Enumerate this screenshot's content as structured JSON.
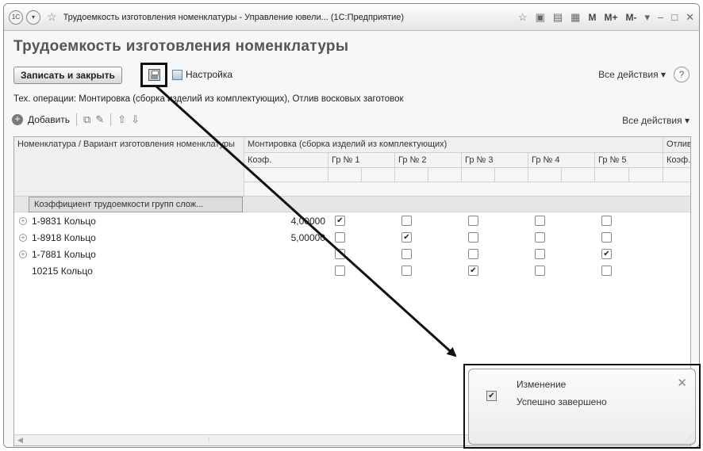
{
  "window": {
    "title": "Трудоемкость изготовления номенклатуры - Управление ювели... (1С:Предприятие)",
    "titlebar_buttons": [
      "M",
      "M+",
      "M-"
    ],
    "logo_text": "1С"
  },
  "page": {
    "title": "Трудоемкость изготовления номенклатуры"
  },
  "toolbar": {
    "save_close_label": "Записать и закрыть",
    "settings_label": "Настройка",
    "all_actions_label": "Все действия ▾",
    "help_label": "?"
  },
  "tech_ops": "Тех. операции: Монтировка (сборка изделий из комплектующих), Отлив восковых заготовок",
  "table_toolbar": {
    "add_label": "Добавить",
    "all_actions_label": "Все действия ▾"
  },
  "grid": {
    "headers": {
      "nomenclature": "Номенклатура / Вариант изготовления номенклатуры",
      "group_montirovka": "Монтировка (сборка изделий из комплектующих)",
      "group_otliv": "Отлив",
      "coef": "Коэф.",
      "gr1": "Гр № 1",
      "gr2": "Гр № 2",
      "gr3": "Гр № 3",
      "gr4": "Гр № 4",
      "gr5": "Гр № 5",
      "coef2": "Коэф."
    },
    "group_row_label": "Коэффициент трудоемкости групп слож...",
    "rows": [
      {
        "name": "1-9831 Кольцо",
        "expandable": true,
        "coef": "4,00000",
        "checks": [
          true,
          false,
          false,
          false,
          false
        ]
      },
      {
        "name": "1-8918 Кольцо",
        "expandable": true,
        "coef": "5,00000",
        "checks": [
          false,
          true,
          false,
          false,
          false
        ]
      },
      {
        "name": "1-7881 Кольцо",
        "expandable": true,
        "coef": "",
        "checks": [
          false,
          false,
          false,
          false,
          true
        ]
      },
      {
        "name": "10215 Кольцо",
        "expandable": false,
        "coef": "",
        "checks": [
          false,
          false,
          true,
          false,
          false
        ]
      }
    ]
  },
  "notification": {
    "title": "Изменение",
    "message": "Успешно завершено",
    "checked": true
  },
  "colors": {
    "callout_box": "#111111",
    "arrow": "#111111"
  }
}
